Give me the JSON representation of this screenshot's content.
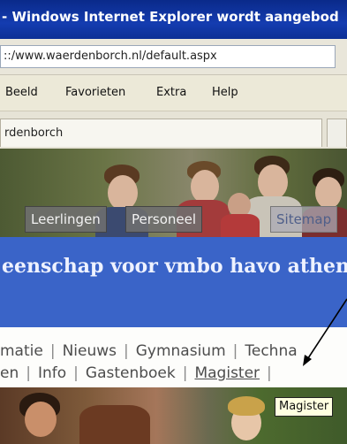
{
  "window": {
    "title": "- Windows Internet Explorer wordt aangebod"
  },
  "address_bar": {
    "url": "::/www.waerdenborch.nl/default.aspx"
  },
  "menu": {
    "items": [
      "Beeld",
      "Favorieten",
      "Extra",
      "Help"
    ]
  },
  "tab": {
    "label": "rdenborch"
  },
  "site_nav": {
    "leerlingen": "Leerlingen",
    "personeel": "Personeel",
    "sitemap": "Sitemap"
  },
  "banner": {
    "tagline": "eenschap voor vmbo havo athen"
  },
  "links": {
    "row1": [
      "matie",
      "Nieuws",
      "Gymnasium",
      "Techna"
    ],
    "row2": [
      "en",
      "Info",
      "Gastenboek",
      "Magister"
    ]
  },
  "tooltip": {
    "text": "Magister"
  },
  "colors": {
    "titlebar": "#0a2a8a",
    "banner": "#3a64c8",
    "tooltip_bg": "#ffffe1"
  }
}
